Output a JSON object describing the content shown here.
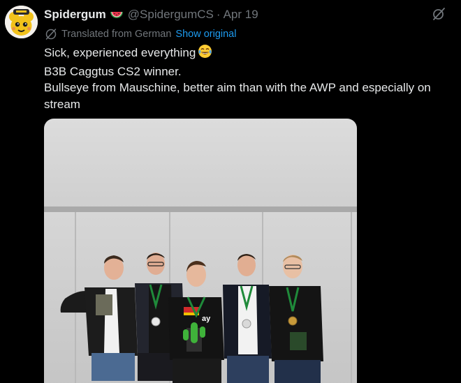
{
  "tweet": {
    "display_name": "Spidergum",
    "handle": "@SpidergumCS",
    "separator": "·",
    "date": "Apr 19",
    "translation_notice": "Translated from German",
    "show_original_label": "Show original",
    "lines": [
      "Sick, experienced everything",
      "B3B Caggtus CS2 winner.",
      "Bullseye from Mauschine, better aim than with the AWP and especially on",
      "stream"
    ]
  },
  "icons": {
    "avatar": "yellow-cartoon-avatar",
    "name_badge": "watermelon-emoji",
    "translate": "globe-translate-icon",
    "top_right": "grok-slash-icon",
    "line1_emoji": "tears-of-joy-emoji"
  },
  "colors": {
    "background": "#000000",
    "primary_text": "#e7e9ea",
    "secondary_text": "#71767b",
    "link": "#1d9bf0"
  },
  "media": {
    "type": "photo",
    "subject": "five-players-with-trophy-and-medals"
  }
}
